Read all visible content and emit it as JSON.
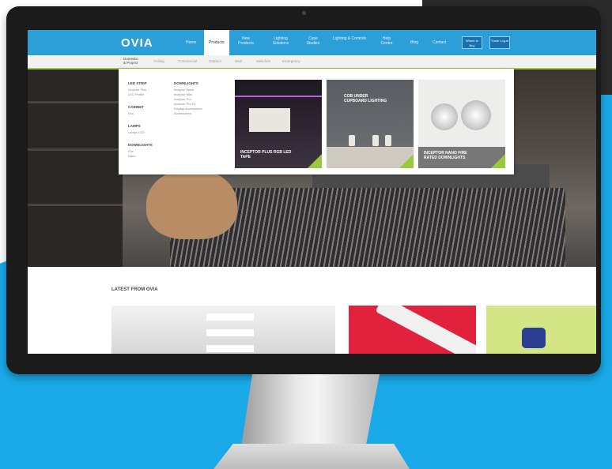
{
  "logo": "OVIA",
  "nav": {
    "items": [
      {
        "label": "Home"
      },
      {
        "label": "Products"
      },
      {
        "label": "New Products"
      },
      {
        "label": "Lighting Solutions"
      },
      {
        "label": "Case Studies"
      },
      {
        "label": "Lighting & Controls"
      },
      {
        "label": "Help Centre"
      },
      {
        "label": "Blog"
      },
      {
        "label": "Contact"
      }
    ],
    "buttons": [
      {
        "label": "Where to Buy"
      },
      {
        "label": "Trade Log-in"
      }
    ]
  },
  "subnav": {
    "items": [
      "Domestic & Project",
      "Ceiling",
      "Commercial",
      "Outdoor",
      "Wall",
      "Switches",
      "Emergency"
    ]
  },
  "dropdown": {
    "col1": [
      {
        "head": "LED STRIP",
        "links": [
          "Inceptor Plus",
          "LED Profile"
        ]
      },
      {
        "head": "CABINET",
        "links": [
          "Eco"
        ]
      },
      {
        "head": "LAMPS",
        "links": [
          "Lamps LED"
        ]
      },
      {
        "head": "DOWNLIGHTS",
        "links": [
          "Fire",
          "Nano"
        ]
      }
    ],
    "col2": [
      {
        "head": "DOWNLIGHTS",
        "links": [
          "Inceptor Nano",
          "Inceptor Mini",
          "Inceptor Pro",
          "Inceptor Pro Fx",
          "Display Accessories",
          "Accessories"
        ]
      }
    ],
    "promos": [
      {
        "label": "INCEPTOR PLUS RGB LED TAPE"
      },
      {
        "label": "COB UNDER CUPBOARD LIGHTING"
      },
      {
        "label": "INCEPTOR NANO FIRE RATED DOWNLIGHTS"
      }
    ]
  },
  "latest": {
    "title": "LATEST FROM OVIA"
  },
  "colors": {
    "accent": "#2d9fd8",
    "brand_green": "#9cc83c",
    "backdrop": "#1aa9e8"
  }
}
